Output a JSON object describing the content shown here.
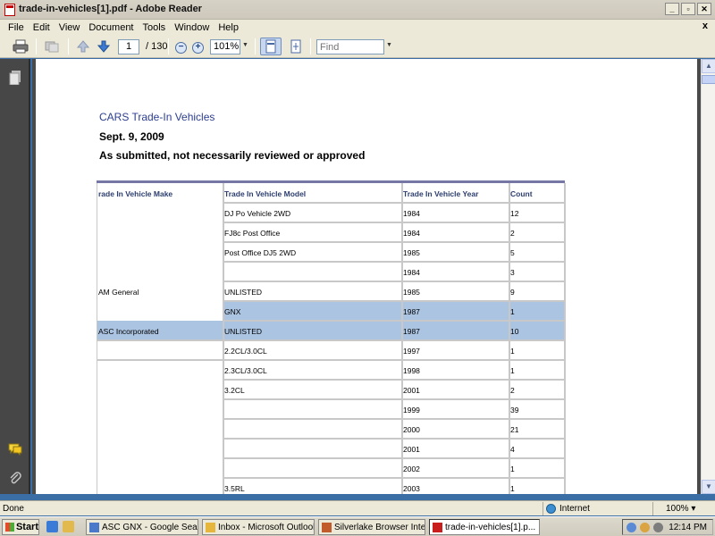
{
  "window": {
    "title": "trade-in-vehicles[1].pdf - Adobe Reader",
    "doc_close": "x"
  },
  "menu": [
    "File",
    "Edit",
    "View",
    "Document",
    "Tools",
    "Window",
    "Help"
  ],
  "toolbar": {
    "page_current": "1",
    "page_total": "/ 130",
    "zoom": "101%",
    "find_placeholder": "Find"
  },
  "document": {
    "heading": "CARS Trade-In Vehicles",
    "date": "Sept. 9, 2009",
    "subtitle": "As submitted, not necessarily reviewed or approved",
    "table": {
      "headers": [
        "rade In Vehicle Make",
        "Trade In Vehicle Model",
        "Trade In Vehicle Year",
        "Count"
      ],
      "rows": [
        [
          "",
          "DJ Po Vehicle 2WD",
          "1984",
          "12"
        ],
        [
          "",
          "FJ8c Post Office",
          "1984",
          "2"
        ],
        [
          "",
          "Post Office DJ5 2WD",
          "1985",
          "5"
        ],
        [
          "",
          "",
          "1984",
          "3"
        ],
        [
          "AM General",
          "UNLISTED",
          "1985",
          "9"
        ],
        [
          "",
          "GNX",
          "1987",
          "1"
        ],
        [
          "ASC Incorporated",
          "UNLISTED",
          "1987",
          "10"
        ],
        [
          "",
          "2.2CL/3.0CL",
          "1997",
          "1"
        ],
        [
          "",
          "2.3CL/3.0CL",
          "1998",
          "1"
        ],
        [
          "",
          "3.2CL",
          "2001",
          "2"
        ],
        [
          "",
          "",
          "1999",
          "39"
        ],
        [
          "",
          "",
          "2000",
          "21"
        ],
        [
          "",
          "",
          "2001",
          "4"
        ],
        [
          "",
          "",
          "2002",
          "1"
        ],
        [
          "",
          "3.5RL",
          "2003",
          "1"
        ]
      ]
    }
  },
  "statusbar": {
    "left": "Done",
    "zone": "Internet",
    "zoom": "100%"
  },
  "taskbar": {
    "start": "Start",
    "tasks": [
      {
        "label": "ASC GNX - Google Search...",
        "color": "#4a79c9"
      },
      {
        "label": "Inbox - Microsoft Outlook",
        "color": "#e5b53c"
      },
      {
        "label": "Silverlake Browser Interface",
        "color": "#c25b2c"
      },
      {
        "label": "trade-in-vehicles[1].p...",
        "color": "#c81e1e"
      }
    ],
    "clock": "12:14 PM"
  }
}
